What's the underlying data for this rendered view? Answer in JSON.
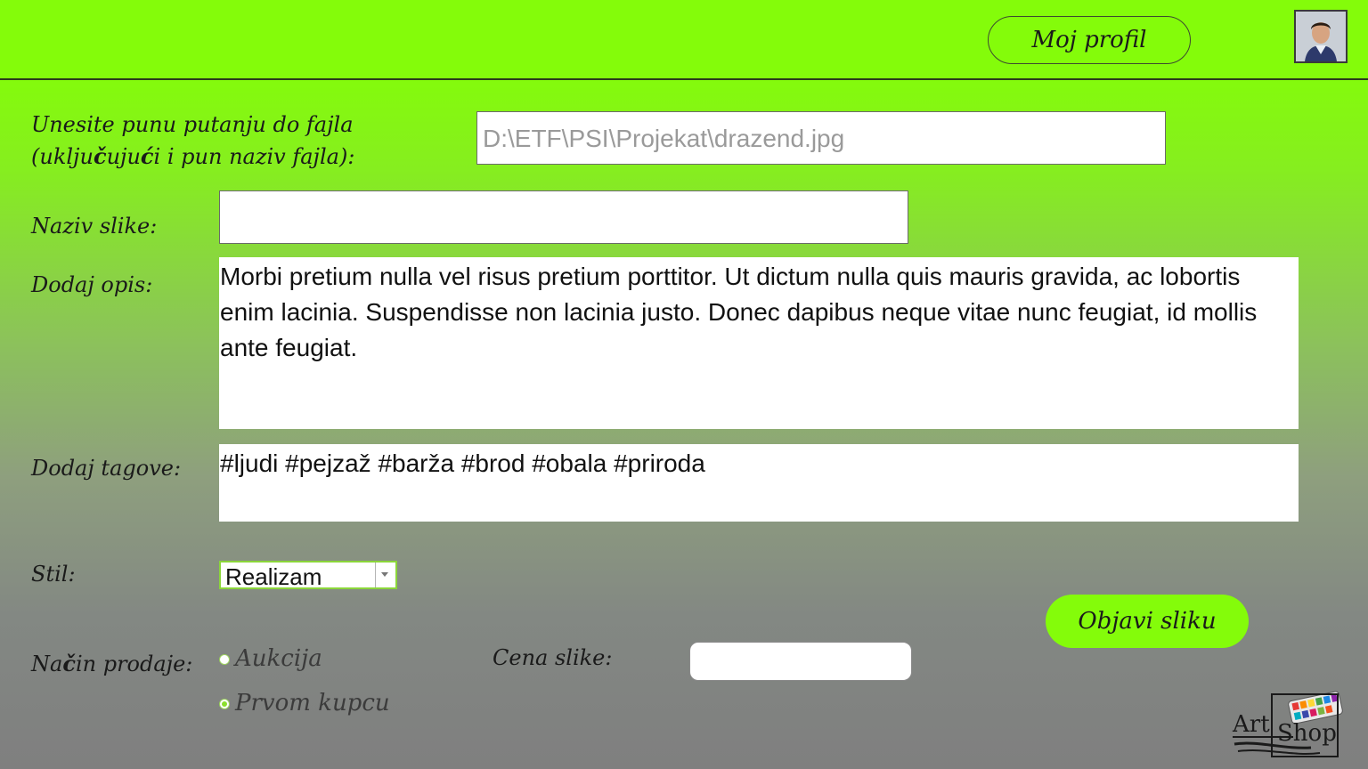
{
  "header": {
    "profile_button": "Moj profil",
    "avatar_icon": "user-avatar"
  },
  "form": {
    "path_label_line1": "Unesite punu putanju do fajla",
    "path_label_line2_pre": "(uklju",
    "path_label_line2_b1": "č",
    "path_label_line2_mid": "uju",
    "path_label_line2_b2": "ć",
    "path_label_line2_post": "i i pun naziv fajla):",
    "path_value": "D:\\ETF\\PSI\\Projekat\\drazend.jpg",
    "name_label": "Naziv slike:",
    "name_value": "",
    "description_label": "Dodaj opis:",
    "description_value": "Morbi pretium nulla vel risus pretium porttitor. Ut dictum nulla quis mauris gravida, ac lobortis enim lacinia. Suspendisse non lacinia justo. Donec dapibus neque vitae nunc feugiat, id mollis ante feugiat.",
    "tags_label": "Dodaj tagove:",
    "tags_value": "#ljudi #pejzaž #barža #brod #obala #priroda",
    "style_label": "Stil:",
    "style_selected": "Realizam",
    "sale_label_pre": "Na",
    "sale_label_b": "č",
    "sale_label_post": "in prodaje:",
    "sale_options": [
      {
        "label": "Aukcija",
        "checked": false
      },
      {
        "label": "Prvom kupcu",
        "checked": true
      }
    ],
    "price_label": "Cena slike:",
    "price_value": "",
    "publish_button": "Objavi sliku"
  },
  "logo": {
    "text_art": "Art",
    "text_shop": "Shop"
  },
  "colors": {
    "accent_green": "#84fc0a",
    "radio_green": "#8be02c"
  }
}
